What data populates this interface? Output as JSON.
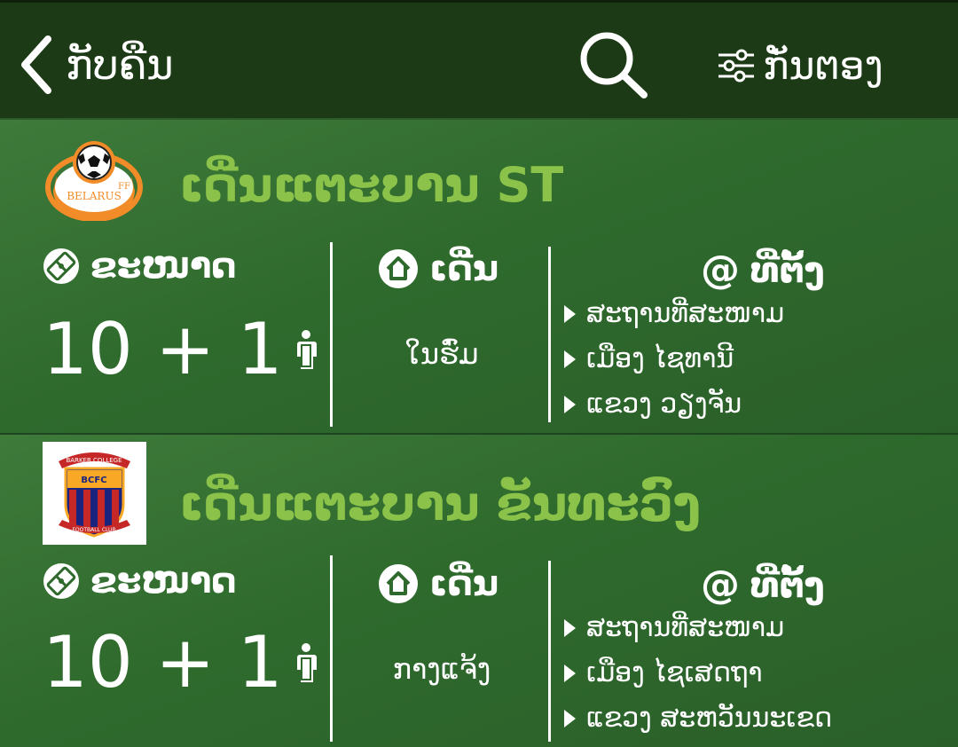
{
  "header": {
    "back_label": "ກັບຄືນ",
    "search_icon": "search-icon",
    "filter_label": "ກັ່ນຕອງ",
    "filter_icon": "sliders-icon",
    "background": "#1d3a17"
  },
  "labels": {
    "size": "ຂະໜາດ",
    "field": "ເດີ່ນ",
    "location": "ທີ່ຕັ້ງ"
  },
  "fields": [
    {
      "name": "ເດີ່ນແຕະບານ ST",
      "logo_text": [
        "BELARUS",
        "FF"
      ],
      "players": "10 + 1",
      "type": "ໃນຮົ່ມ",
      "location": [
        "ສະຖານທີ່ສະໜາມ",
        "ເມືອງ ໄຊທານີ",
        "ແຂວງ ວຽງຈັນ"
      ]
    },
    {
      "name": "ເດີ່ນແຕະບານ ຂັນທະວົງ",
      "logo_text": [
        "BARKER COLLEGE",
        "BCFC",
        "FOOTBALL CLUB"
      ],
      "players": "10 + 1",
      "type": "ກາງແຈ້ງ",
      "location": [
        "ສະຖານທີ່ສະໜາມ",
        "ເມືອງ ໄຊເສດຖາ",
        "ແຂວງ ສະຫວັນນະເຂດ"
      ]
    }
  ],
  "colors": {
    "accent_title": "#8bc34a",
    "card": "#2f6a2d",
    "text": "#ffffff"
  }
}
